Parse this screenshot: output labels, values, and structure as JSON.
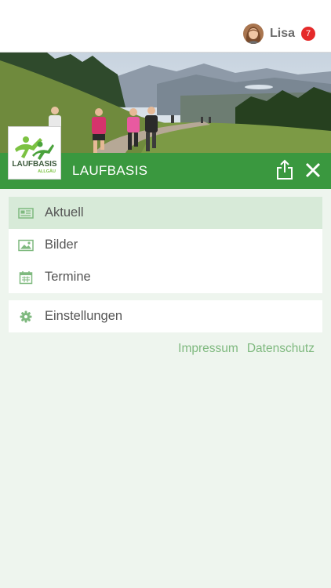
{
  "user": {
    "name": "Lisa",
    "notification_count": "7",
    "avatar_icon": "user-avatar"
  },
  "header": {
    "title": "LAUFBASIS",
    "share_icon": "share-icon",
    "close_icon": "close-icon"
  },
  "logo": {
    "text_main": "LAUFBASIS",
    "text_sub": "ALLGÄU"
  },
  "menu": {
    "items": [
      {
        "label": "Aktuell",
        "icon": "newspaper-icon",
        "active": true
      },
      {
        "label": "Bilder",
        "icon": "image-icon",
        "active": false
      },
      {
        "label": "Termine",
        "icon": "calendar-icon",
        "active": false
      }
    ],
    "settings": {
      "label": "Einstellungen",
      "icon": "gear-icon"
    }
  },
  "footer": {
    "impressum": "Impressum",
    "datenschutz": "Datenschutz"
  },
  "colors": {
    "accent": "#3a983f",
    "active_bg": "#d7ead8",
    "page_bg": "#eef5ee",
    "link": "#7fb97f",
    "badge": "#e52a2a"
  }
}
